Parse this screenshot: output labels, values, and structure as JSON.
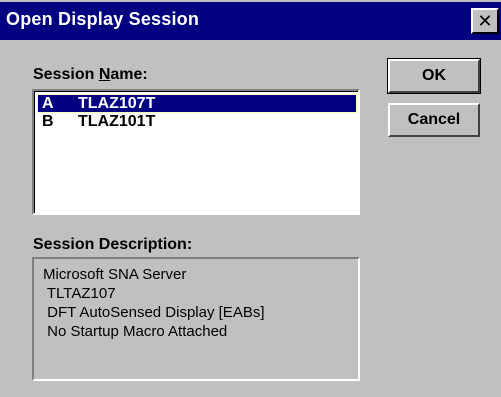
{
  "window": {
    "title": "Open Display Session",
    "close_glyph": "✕"
  },
  "session_name": {
    "label_prefix": "Session ",
    "label_accel": "N",
    "label_suffix": "ame:",
    "items": [
      {
        "key": "A",
        "name": "TLAZ107T",
        "selected": true
      },
      {
        "key": "B",
        "name": "TLAZ101T",
        "selected": false
      }
    ]
  },
  "buttons": {
    "ok": "OK",
    "cancel": "Cancel"
  },
  "session_description": {
    "label": "Session Description:",
    "lines": [
      "Microsoft SNA Server",
      " TLTAZ107",
      " DFT AutoSensed Display [EABs]",
      " No Startup Macro Attached"
    ]
  },
  "colors": {
    "titlebar": "#000080",
    "selection": "#000080",
    "face": "#c0c0c0"
  }
}
